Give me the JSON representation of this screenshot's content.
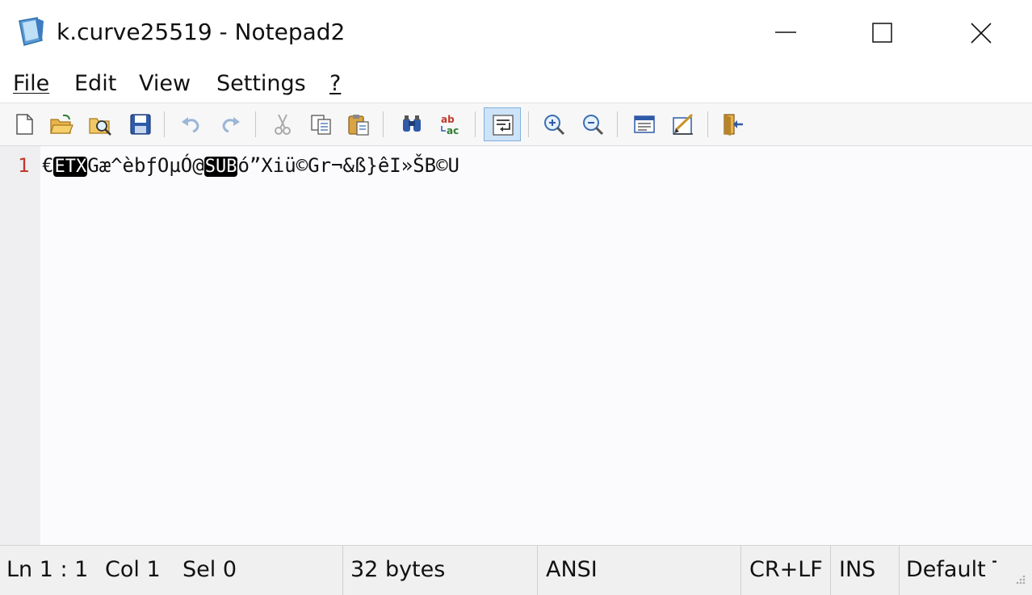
{
  "window": {
    "title": "k.curve25519 - Notepad2",
    "app_icon": "notepad-icon",
    "controls": [
      "minimize-icon",
      "maximize-icon",
      "close-icon"
    ]
  },
  "menu": {
    "items": [
      {
        "label": "File"
      },
      {
        "label": "Edit"
      },
      {
        "label": "View"
      },
      {
        "label": "Settings"
      },
      {
        "label": "?"
      }
    ]
  },
  "toolbar": {
    "buttons": [
      "new-file-icon",
      "open-folder-icon",
      "browse-icon",
      "save-icon",
      "undo-icon",
      "redo-icon",
      "cut-icon",
      "copy-icon",
      "paste-icon",
      "find-icon",
      "replace-icon",
      "word-wrap-icon",
      "zoom-in-icon",
      "zoom-out-icon",
      "select-scheme-icon",
      "customize-schemes-icon",
      "exit-icon"
    ],
    "active_button": "word-wrap-icon"
  },
  "editor": {
    "line_number": "1",
    "segments": [
      {
        "text": "€",
        "ctrl": false
      },
      {
        "text": "ETX",
        "ctrl": true
      },
      {
        "text": "Gæ^èbƒOµÓ@",
        "ctrl": false
      },
      {
        "text": "SUB",
        "ctrl": true
      },
      {
        "text": "ó”Xiü©Gr¬&ß}êI»ŠB©U",
        "ctrl": false
      }
    ]
  },
  "status": {
    "position": "Ln 1 : 1",
    "column": "Col 1",
    "selection": "Sel 0",
    "size": "32 bytes",
    "encoding": "ANSI",
    "line_endings": "CR+LF",
    "mode": "INS",
    "scheme": "Default T"
  },
  "colors": {
    "line_number": "#c0392b",
    "gutter": "#efeef1",
    "editor_bg": "#fbfafc",
    "active_toolbar": "#cde3f7"
  }
}
